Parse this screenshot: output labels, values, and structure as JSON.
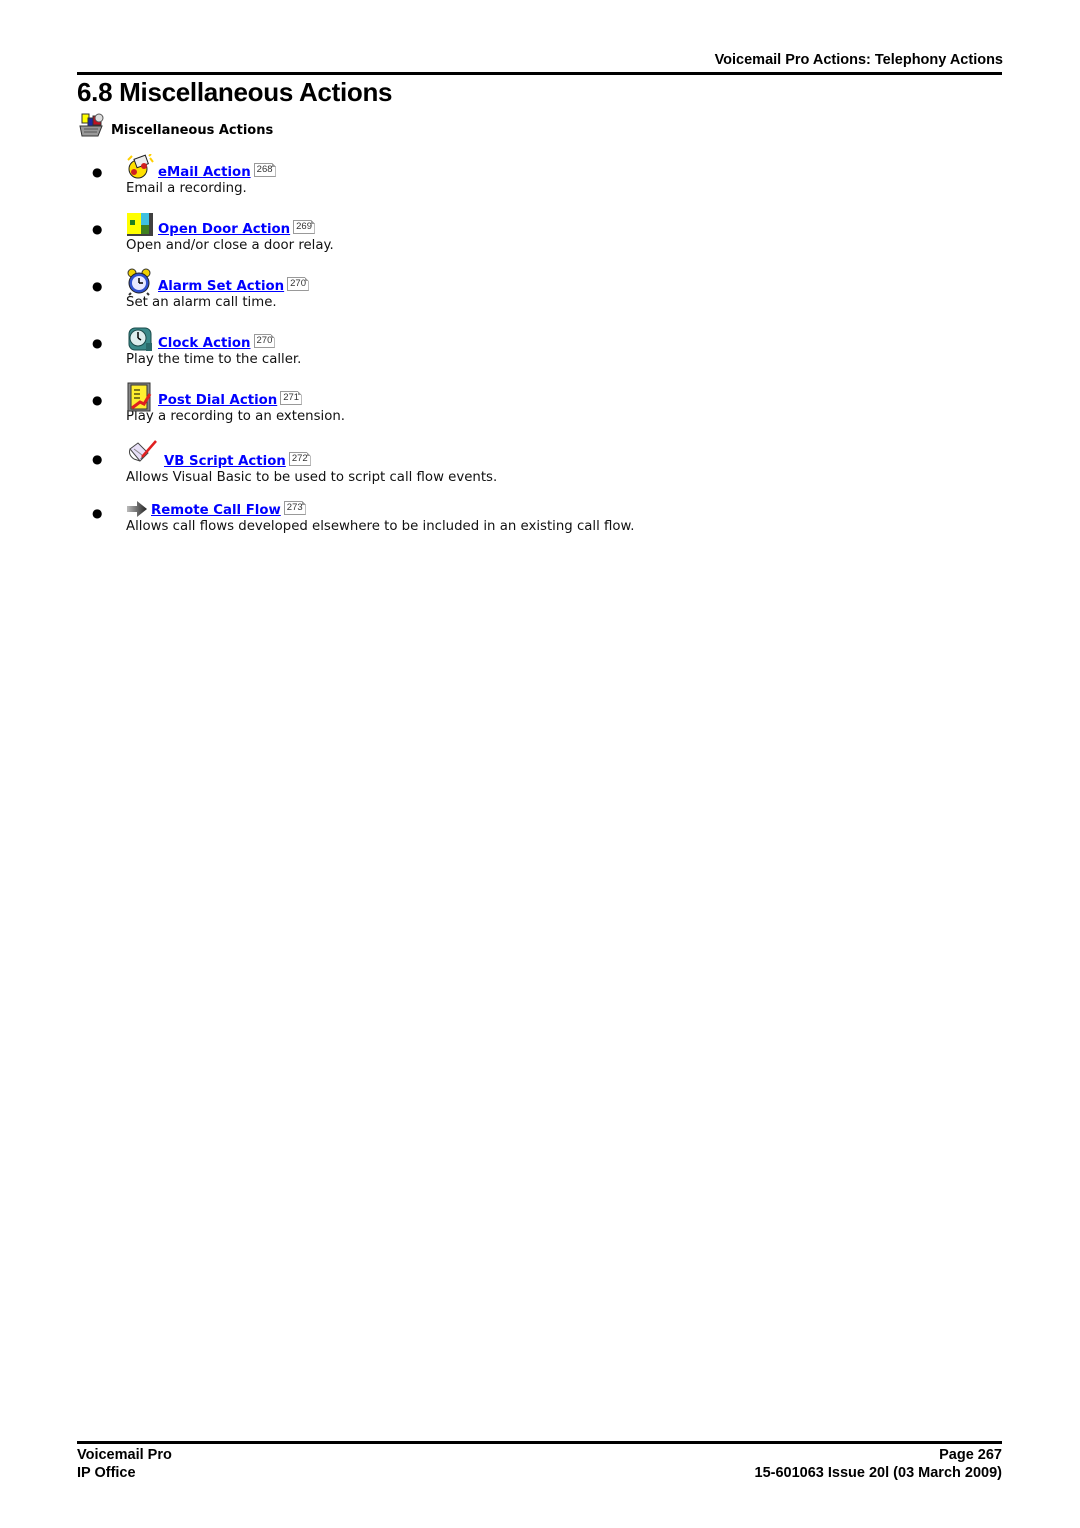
{
  "header": {
    "running_title": "Voicemail Pro Actions: Telephony Actions",
    "page_title": "6.8 Miscellaneous Actions"
  },
  "section": {
    "icon": "misc-actions-icon",
    "label": "Miscellaneous Actions"
  },
  "items": [
    {
      "icon": "email-icon",
      "title": "eMail Action",
      "page_ref": "268",
      "description": "Email a recording."
    },
    {
      "icon": "open-door-icon",
      "title": "Open Door Action",
      "page_ref": "269",
      "description": "Open and/or close a door relay."
    },
    {
      "icon": "alarm-clock-icon",
      "title": "Alarm Set Action",
      "page_ref": "270",
      "description": "Set an alarm call time."
    },
    {
      "icon": "clock-icon",
      "title": "Clock Action",
      "page_ref": "270",
      "description": "Play the time to the caller."
    },
    {
      "icon": "post-dial-icon",
      "title": "Post Dial Action",
      "page_ref": "271",
      "description": "Play a recording to an extension."
    },
    {
      "icon": "vb-script-icon",
      "title": "VB Script Action",
      "page_ref": "272",
      "description": "Allows Visual Basic to be used to script call flow events."
    },
    {
      "icon": "arrow-right-icon",
      "title": "Remote Call Flow",
      "page_ref": "273",
      "description": "Allows call flows developed elsewhere to be included in an existing call flow."
    }
  ],
  "footer": {
    "product": "Voicemail Pro",
    "platform": "IP Office",
    "page": "Page 267",
    "issue": "15-601063 Issue 20l (03 March 2009)"
  },
  "colors": {
    "link": "#0000ff",
    "text": "#000000"
  }
}
